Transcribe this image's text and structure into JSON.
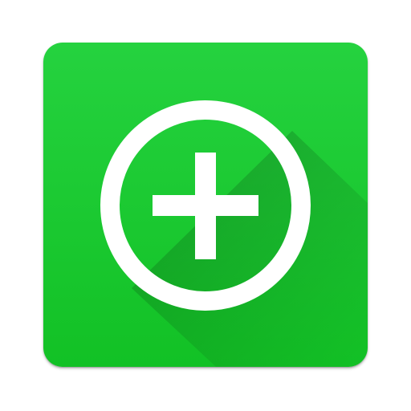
{
  "app_icon": {
    "icon": "add-circle-icon",
    "colors": {
      "tile_top": "#25d23f",
      "tile_bottom": "#12c125",
      "symbol": "#ffffff",
      "long_shadow": "#000000"
    }
  }
}
